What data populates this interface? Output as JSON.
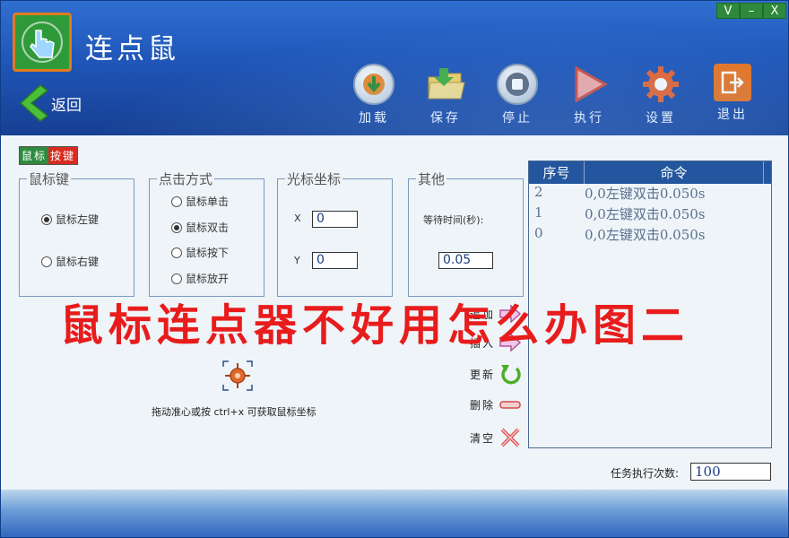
{
  "window": {
    "controls": [
      "V",
      "–",
      "X"
    ]
  },
  "header": {
    "title": "连点鼠",
    "back_label": "返回",
    "toolbar": [
      {
        "key": "load",
        "label": "加载",
        "icon": "load-icon"
      },
      {
        "key": "save",
        "label": "保存",
        "icon": "save-folder-icon"
      },
      {
        "key": "stop",
        "label": "停止",
        "icon": "stop-icon"
      },
      {
        "key": "run",
        "label": "执行",
        "icon": "play-icon"
      },
      {
        "key": "settings",
        "label": "设置",
        "icon": "gear-icon"
      },
      {
        "key": "exit",
        "label": "退出",
        "icon": "exit-icon"
      }
    ]
  },
  "mode_badge": {
    "part1": "鼠标",
    "part2": "按键"
  },
  "mouse_key": {
    "legend": "鼠标键",
    "options": [
      "鼠标左键",
      "鼠标右键"
    ],
    "selected": 0
  },
  "click_mode": {
    "legend": "点击方式",
    "options": [
      "鼠标单击",
      "鼠标双击",
      "鼠标按下",
      "鼠标放开"
    ],
    "selected": 1
  },
  "cursor_pos": {
    "legend": "光标坐标",
    "x_label": "X",
    "x_value": "0",
    "y_label": "Y",
    "y_value": "0"
  },
  "other": {
    "legend": "其他",
    "wait_label": "等待时间(秒):",
    "wait_value": "0.05"
  },
  "actions": [
    {
      "key": "append",
      "label": "追加",
      "icon": "arrow-right-icon"
    },
    {
      "key": "insert",
      "label": "插入",
      "icon": "arrow-right-icon"
    },
    {
      "key": "update",
      "label": "更新",
      "icon": "refresh-icon"
    },
    {
      "key": "delete",
      "label": "删除",
      "icon": "minus-icon"
    },
    {
      "key": "clear",
      "label": "清空",
      "icon": "x-icon"
    }
  ],
  "crosshair_hint": "拖动准心或按 ctrl+x 可获取鼠标坐标",
  "command_table": {
    "columns": [
      "序号",
      "命令"
    ],
    "rows": [
      [
        "2",
        "0,0左键双击0.050s"
      ],
      [
        "1",
        "0,0左键双击0.050s"
      ],
      [
        "0",
        "0,0左键双击0.050s"
      ]
    ]
  },
  "task_count": {
    "label": "任务执行次数:",
    "value": "100"
  },
  "overlay_caption": "鼠标连点器不好用怎么办图二"
}
